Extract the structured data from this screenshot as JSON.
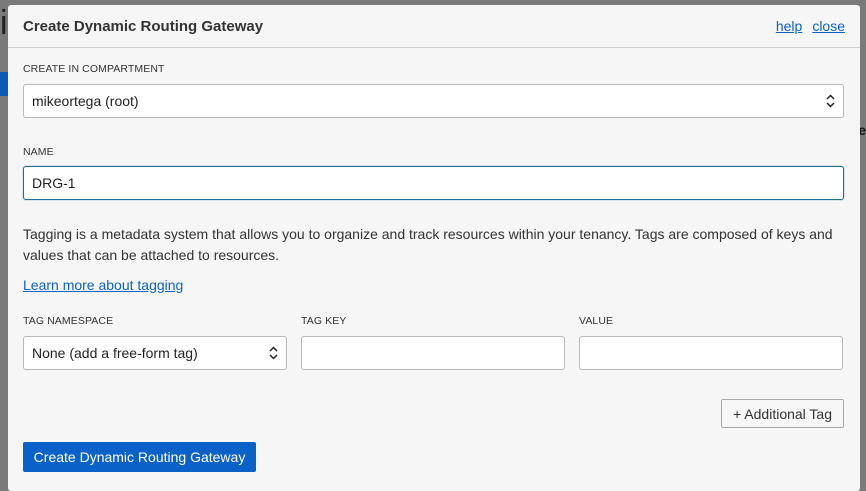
{
  "background": {
    "glyph": "i",
    "right_text": "re"
  },
  "modal": {
    "title": "Create Dynamic Routing Gateway",
    "help_link": "help",
    "close_link": "close"
  },
  "compartment": {
    "label": "CREATE IN COMPARTMENT",
    "value": "mikeortega (root)"
  },
  "name": {
    "label": "NAME",
    "value": "DRG-1"
  },
  "tagging": {
    "description": "Tagging is a metadata system that allows you to organize and track resources within your tenancy. Tags are composed of keys and values that can be attached to resources.",
    "learn_more": "Learn more about tagging"
  },
  "tags": {
    "namespace_label": "TAG NAMESPACE",
    "namespace_value": "None (add a free-form tag)",
    "key_label": "TAG KEY",
    "key_value": "",
    "value_label": "VALUE",
    "value_value": ""
  },
  "buttons": {
    "additional_tag": "+ Additional Tag",
    "create": "Create Dynamic Routing Gateway"
  },
  "colors": {
    "accent": "#0a62c9",
    "focus_border": "#1e6f95"
  }
}
